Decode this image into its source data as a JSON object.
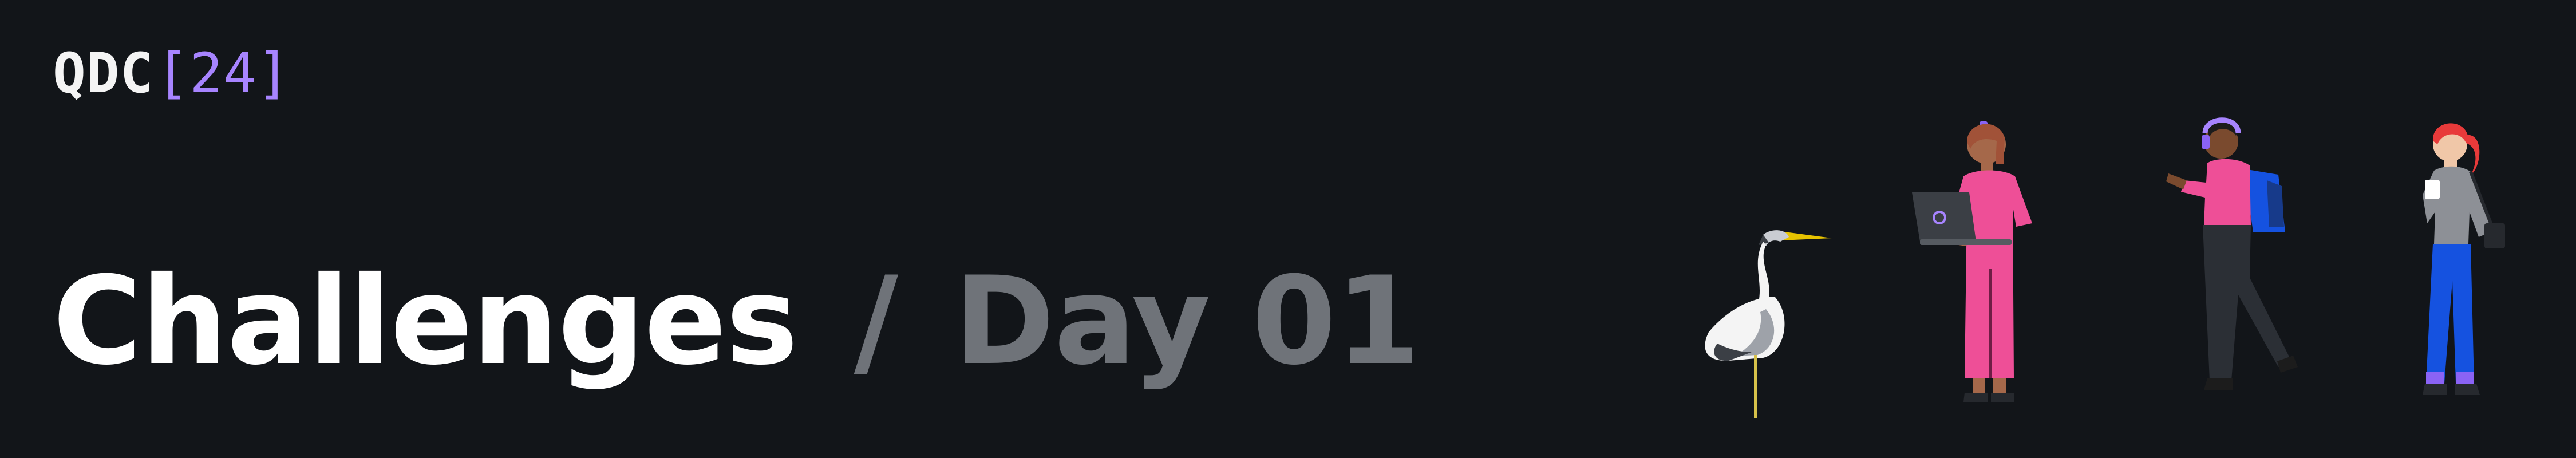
{
  "logo": {
    "word": "QDC",
    "year_bracketed": "[24]"
  },
  "headline": {
    "title": "Challenges",
    "separator": "/",
    "subtitle": "Day 01"
  },
  "colors": {
    "background": "#121519",
    "title": "#ffffff",
    "subtitle": "#6f7379",
    "accent": "#a784ff",
    "pink": "#ee4f97",
    "blue": "#1552e0",
    "purple": "#8a63f5"
  },
  "illustration": {
    "figures": [
      "heron-icon",
      "person-with-laptop-icon",
      "person-with-headphones-icon",
      "person-with-coffee-icon"
    ]
  }
}
